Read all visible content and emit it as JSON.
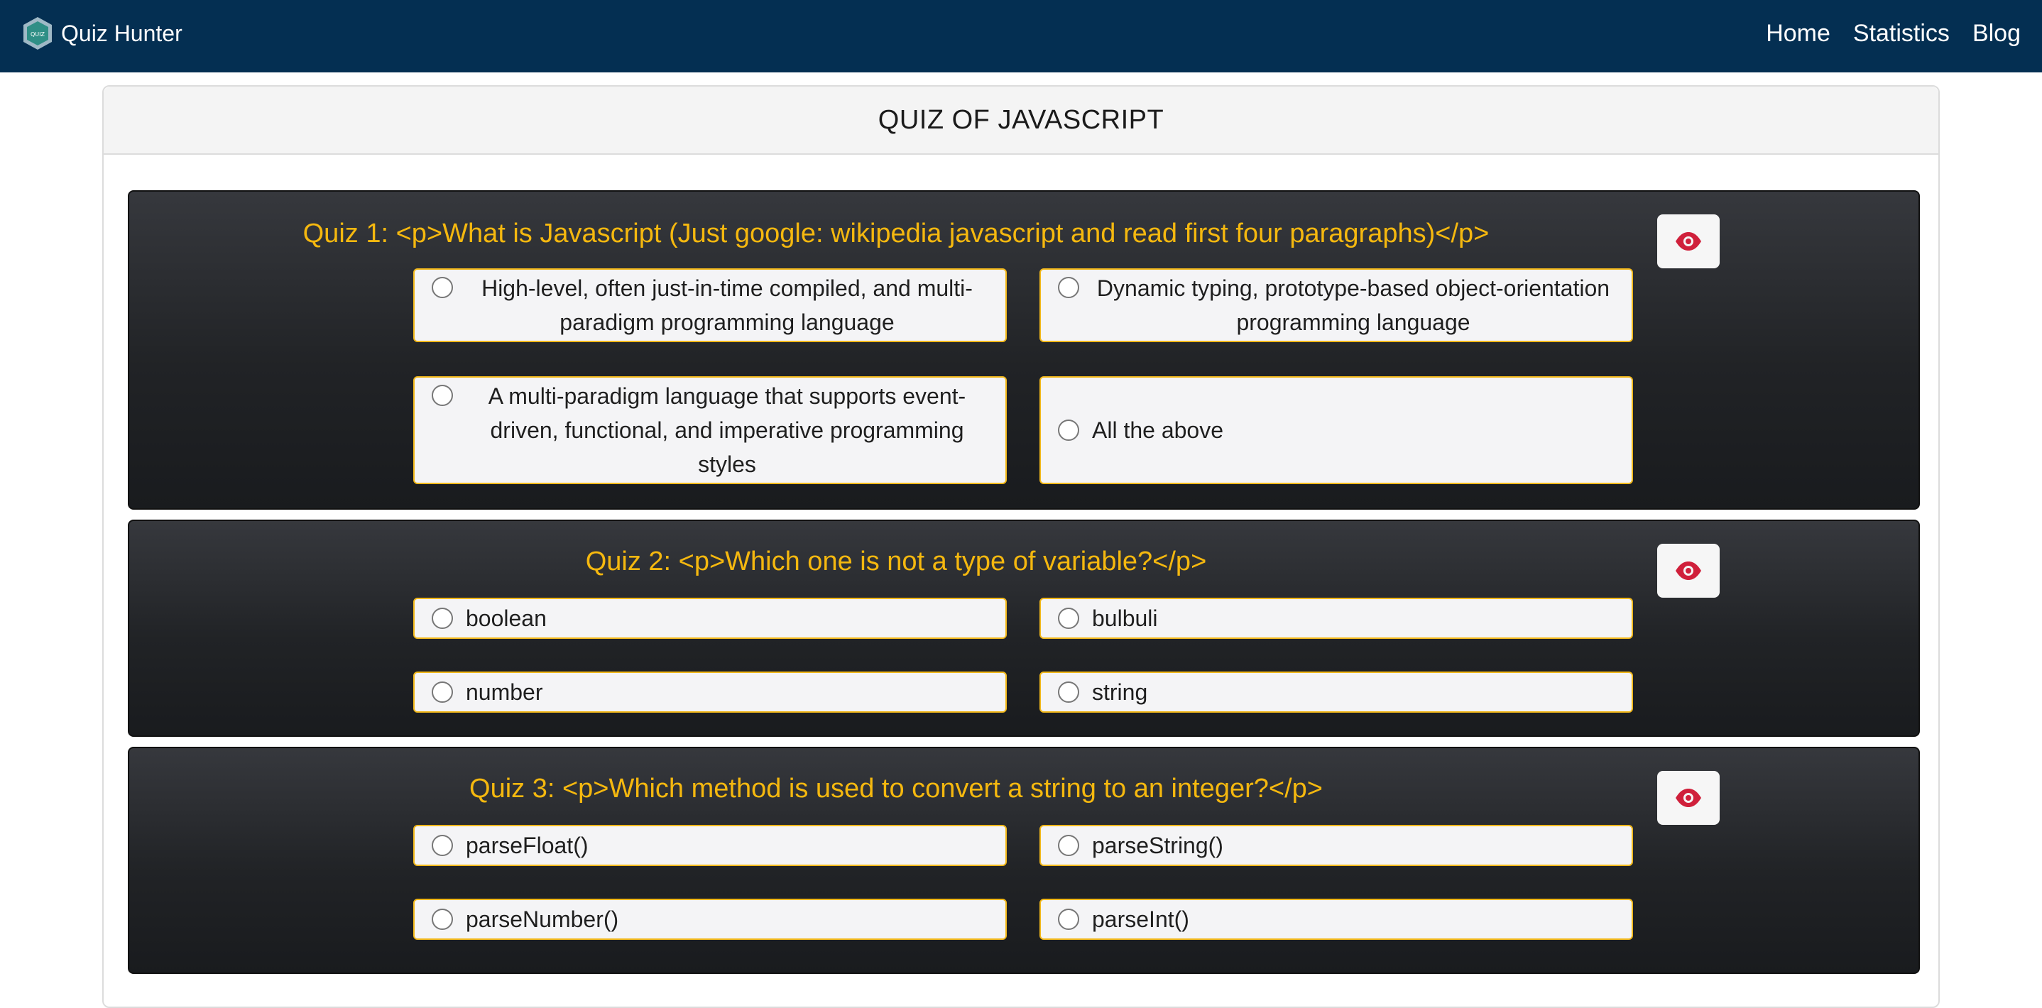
{
  "navbar": {
    "brand": "Quiz Hunter",
    "logo_icon": "quiz-logo-icon",
    "links": [
      "Home",
      "Statistics",
      "Blog"
    ],
    "background": "#042f52"
  },
  "page": {
    "title": "QUIZ OF JAVASCRIPT"
  },
  "quizzes": [
    {
      "question": "Quiz 1: <p>What is Javascript (Just google: wikipedia javascript and read first four paragraphs)</p>",
      "options": [
        "High-level, often just-in-time compiled, and multi-paradigm programming language",
        "Dynamic typing, prototype-based object-orientation programming language",
        "A multi-paradigm language that supports event-driven, functional, and imperative programming styles",
        "All the above"
      ]
    },
    {
      "question": "Quiz 2: <p>Which one is not a type of variable?</p>",
      "options": [
        "boolean",
        "bulbuli",
        "number",
        "string"
      ]
    },
    {
      "question": "Quiz 3: <p>Which method is used to convert a string to an integer?</p>",
      "options": [
        "parseFloat()",
        "parseString()",
        "parseNumber()",
        "parseInt()"
      ]
    }
  ],
  "colors": {
    "question_text": "#f5b80f",
    "option_border": "#f2b81a",
    "eye_icon": "#d0203b"
  },
  "icons": {
    "reveal_answer": "eye-icon"
  }
}
